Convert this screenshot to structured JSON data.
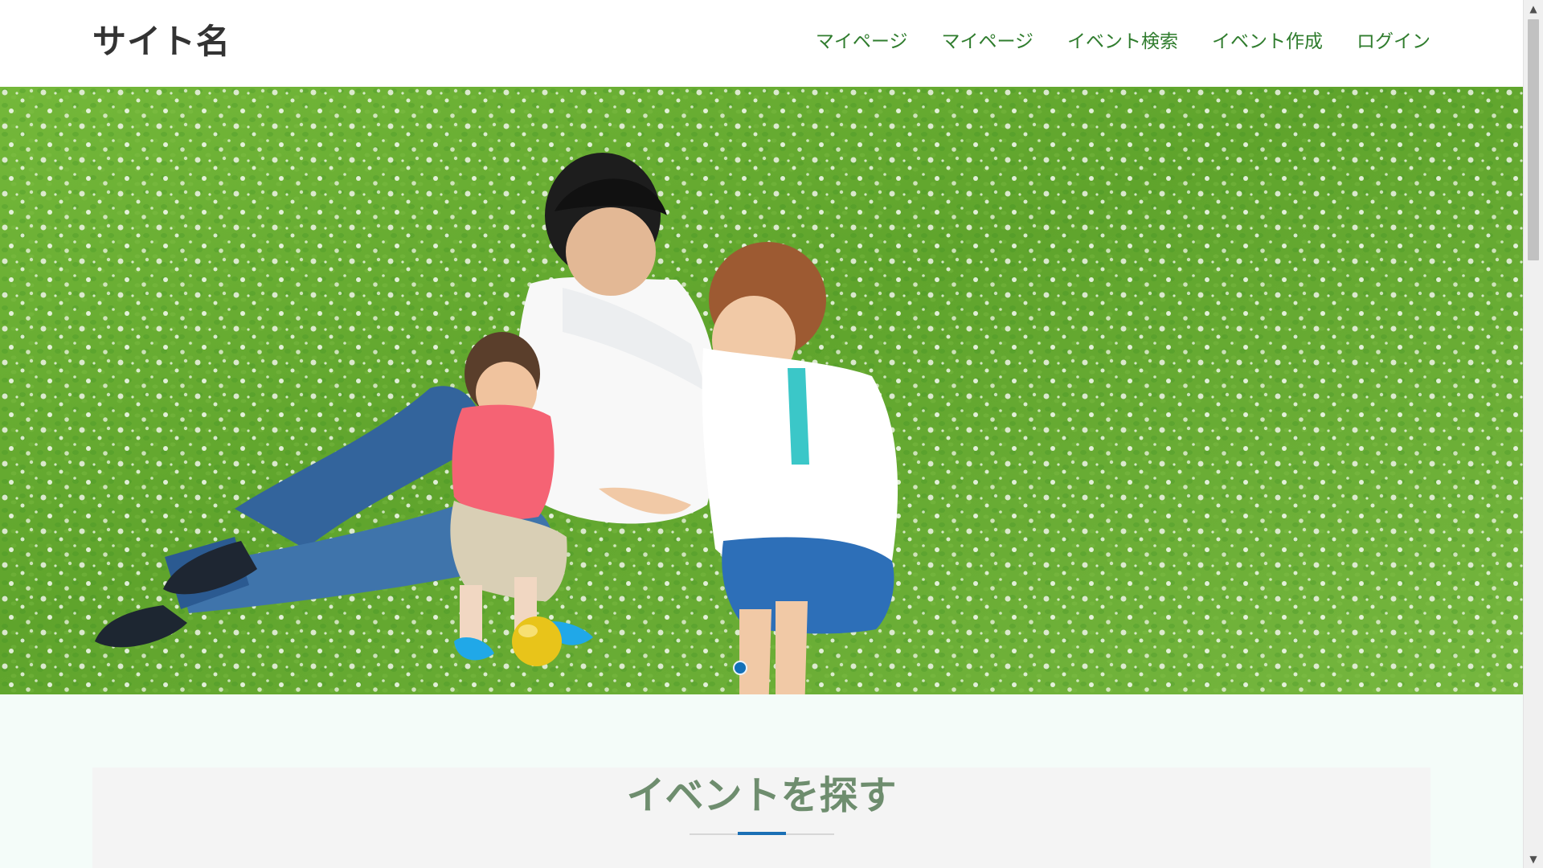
{
  "header": {
    "site_name": "サイト名",
    "nav": [
      {
        "label": "マイページ"
      },
      {
        "label": "マイページ"
      },
      {
        "label": "イベント検索"
      },
      {
        "label": "イベント作成"
      },
      {
        "label": "ログイン"
      }
    ],
    "nav_color": "#2f7c2d"
  },
  "hero": {
    "image_subject": "family sitting on clover field",
    "active_slide": 1
  },
  "search_section": {
    "heading": "イベントを探す",
    "heading_color": "#6e8d6e",
    "accent_color": "#1a6fb5"
  },
  "scrollbar": {
    "up_icon": "▲",
    "down_icon": "▼"
  }
}
